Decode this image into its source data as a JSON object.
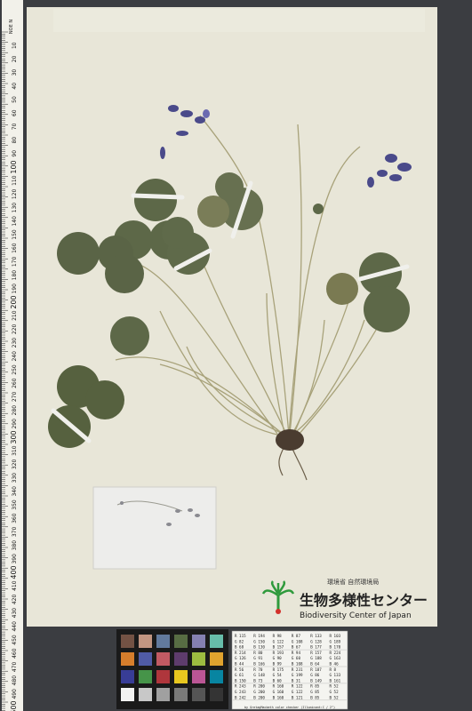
{
  "ruler": {
    "header": "NOE N",
    "marks": [
      "10",
      "20",
      "30",
      "40",
      "50",
      "60",
      "70",
      "80",
      "90",
      "100",
      "110",
      "120",
      "130",
      "140",
      "150",
      "160",
      "170",
      "180",
      "190",
      "200",
      "210",
      "220",
      "230",
      "240",
      "250",
      "260",
      "270",
      "280",
      "290",
      "300",
      "310",
      "320",
      "330",
      "340",
      "350",
      "360",
      "370",
      "380",
      "390",
      "400",
      "410",
      "420",
      "430",
      "440",
      "450",
      "460",
      "470",
      "480",
      "490",
      "500"
    ]
  },
  "label": {
    "agency": "環境省 自然環境局",
    "center_jp": "生物多様性センター",
    "center_en": "Biodiversity Center of Japan"
  },
  "color_table": {
    "rows": [
      [
        "R 115",
        "R 194",
        "R 98",
        "R 87",
        "R 133",
        "R 103"
      ],
      [
        "G 82",
        "G 150",
        "G 122",
        "G 108",
        "G 128",
        "G 189"
      ],
      [
        "B 68",
        "B 130",
        "B 157",
        "B 67",
        "B 177",
        "B 170"
      ],
      [
        "R 214",
        "R 80",
        "R 193",
        "R 94",
        "R 157",
        "R 224"
      ],
      [
        "G 126",
        "G 91",
        "G 90",
        "G 60",
        "G 188",
        "G 163"
      ],
      [
        "B 44",
        "B 166",
        "B 99",
        "B 108",
        "B 64",
        "B 46"
      ],
      [
        "R 56",
        "R 70",
        "R 175",
        "R 231",
        "R 187",
        "R 8"
      ],
      [
        "G 61",
        "G 148",
        "G 54",
        "G 199",
        "G 86",
        "G 133"
      ],
      [
        "B 150",
        "B 73",
        "B 60",
        "B 31",
        "B 149",
        "B 161"
      ],
      [
        "R 243",
        "R 200",
        "R 160",
        "R 122",
        "R 85",
        "R 52"
      ],
      [
        "G 243",
        "G 200",
        "G 160",
        "G 122",
        "G 85",
        "G 52"
      ],
      [
        "B 242",
        "B 200",
        "B 160",
        "B 121",
        "B 85",
        "B 52"
      ]
    ],
    "caption": "by GretagMacbeth color checker (Illuminant:C / 2°)"
  },
  "colors": {
    "background": "#3b3d41",
    "sheet": "#e8e6d8",
    "leaf": "#5d6848",
    "leaf_light": "#7a7d58",
    "flower": "#4a4a8a",
    "logo_green": "#2f9a3c",
    "logo_red": "#d2302a"
  },
  "checker_swatches": [
    "#735244",
    "#c29682",
    "#627a9d",
    "#576c43",
    "#8580b1",
    "#67bdaa",
    "#d67e2c",
    "#505ba6",
    "#c15a63",
    "#5e3c6c",
    "#9dbc40",
    "#e0a32e",
    "#383d96",
    "#469449",
    "#af363c",
    "#e7c71f",
    "#bb5695",
    "#0885a1",
    "#f3f3f2",
    "#c8c8c8",
    "#a0a0a0",
    "#7a7a79",
    "#555555",
    "#343434"
  ]
}
